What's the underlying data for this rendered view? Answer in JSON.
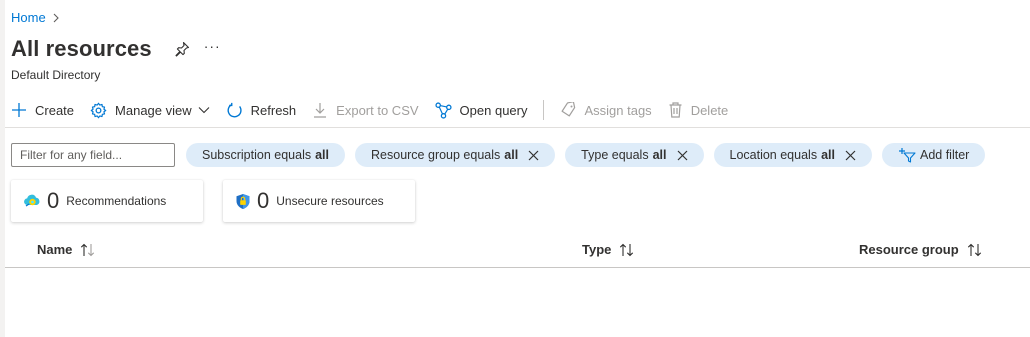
{
  "breadcrumb": {
    "home": "Home"
  },
  "header": {
    "title": "All resources",
    "subtitle": "Default Directory",
    "more": "···"
  },
  "toolbar": {
    "create": "Create",
    "manage_view": "Manage view",
    "refresh": "Refresh",
    "export_csv": "Export to CSV",
    "open_query": "Open query",
    "assign_tags": "Assign tags",
    "delete": "Delete"
  },
  "filters": {
    "placeholder": "Filter for any field...",
    "subscription": {
      "label": "Subscription equals",
      "value": "all"
    },
    "resource_group": {
      "label": "Resource group equals",
      "value": "all"
    },
    "type": {
      "label": "Type equals",
      "value": "all"
    },
    "location": {
      "label": "Location equals",
      "value": "all"
    },
    "add": "Add filter"
  },
  "cards": {
    "recommendations": {
      "count": "0",
      "label": "Recommendations"
    },
    "unsecure": {
      "count": "0",
      "label": "Unsecure resources"
    }
  },
  "table": {
    "columns": [
      "Name",
      "Type",
      "Resource group"
    ]
  },
  "colors": {
    "accent": "#0078d4",
    "pill_bg": "#deecf9",
    "disabled": "#a19f9d"
  }
}
